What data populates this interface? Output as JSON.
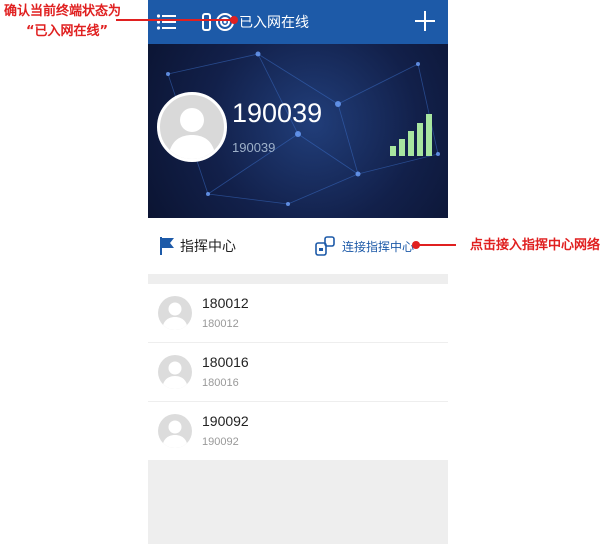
{
  "annotations": {
    "status_note_line1": "确认当前终端状态为",
    "status_note_line2": "“已入网在线”",
    "connect_note": "点击接入指挥中心网络"
  },
  "topbar": {
    "status_text": "已入网在线",
    "menu_icon": "list-menu-icon",
    "add_icon": "plus-icon"
  },
  "profile": {
    "number": "190039",
    "sub_number": "190039",
    "signal_level": 1.0
  },
  "command_center": {
    "title": "指挥中心",
    "connect_label": "连接指挥中心"
  },
  "contacts": [
    {
      "name": "180012",
      "id": "180012"
    },
    {
      "name": "180016",
      "id": "180016"
    },
    {
      "name": "190092",
      "id": "190092"
    }
  ],
  "colors": {
    "brand_blue": "#1d5aa8",
    "annotation_red": "#e02020",
    "signal_green": "#a8e6a0"
  }
}
